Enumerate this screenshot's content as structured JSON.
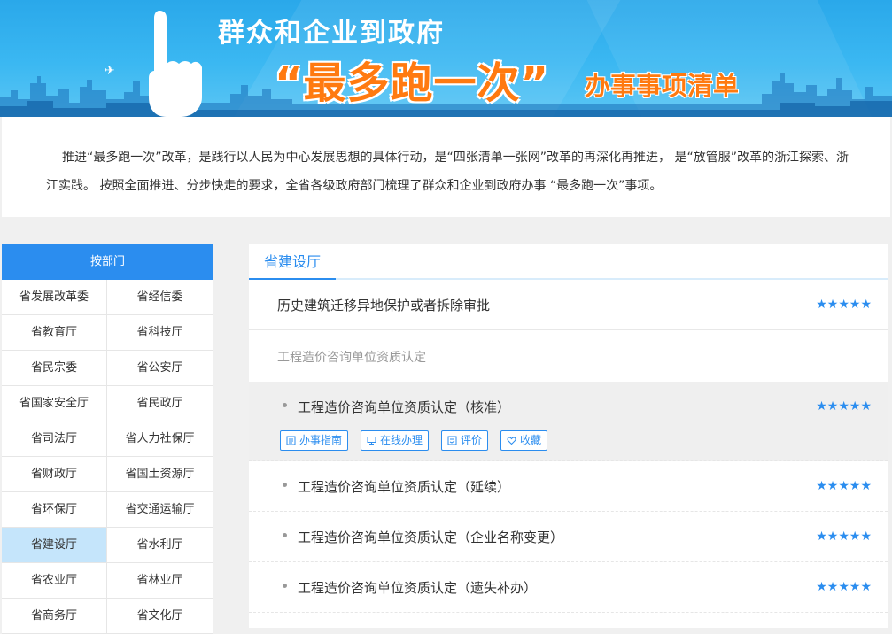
{
  "banner": {
    "line1": "群众和企业到政府",
    "quote": "“最多跑一次”",
    "line2": "办事事项清单"
  },
  "intro": {
    "text": "推进“最多跑一次”改革，是践行以人民为中心发展思想的具体行动，是“四张清单一张网”改革的再深化再推进， 是“放管服”改革的浙江探索、浙江实践。 按照全面推进、分步快走的要求，全省各级政府部门梳理了群众和企业到政府办事 “最多跑一次”事项。"
  },
  "sidebar": {
    "header": "按部门",
    "items": [
      {
        "label": "省发展改革委"
      },
      {
        "label": "省经信委"
      },
      {
        "label": "省教育厅"
      },
      {
        "label": "省科技厅"
      },
      {
        "label": "省民宗委"
      },
      {
        "label": "省公安厅"
      },
      {
        "label": "省国家安全厅"
      },
      {
        "label": "省民政厅"
      },
      {
        "label": "省司法厅"
      },
      {
        "label": "省人力社保厅"
      },
      {
        "label": "省财政厅"
      },
      {
        "label": "省国土资源厅"
      },
      {
        "label": "省环保厅"
      },
      {
        "label": "省交通运输厅"
      },
      {
        "label": "省建设厅"
      },
      {
        "label": "省水利厅"
      },
      {
        "label": "省农业厅"
      },
      {
        "label": "省林业厅"
      },
      {
        "label": "省商务厅"
      },
      {
        "label": "省文化厅"
      }
    ],
    "active_label": "省建设厅"
  },
  "main": {
    "tab": "省建设厅",
    "rows": [
      {
        "label": "历史建筑迁移异地保护或者拆除审批",
        "stars": "★★★★★"
      },
      {
        "group": "工程造价咨询单位资质认定"
      },
      {
        "label": "工程造价咨询单位资质认定（核准）",
        "stars": "★★★★★"
      },
      {
        "label": "工程造价咨询单位资质认定（延续）",
        "stars": "★★★★★"
      },
      {
        "label": "工程造价咨询单位资质认定（企业名称变更）",
        "stars": "★★★★★"
      },
      {
        "label": "工程造价咨询单位资质认定（遗失补办）",
        "stars": "★★★★★"
      }
    ],
    "actions": {
      "guide": "办事指南",
      "online": "在线办理",
      "rate": "评价",
      "fav": "收藏"
    }
  },
  "colors": {
    "accent": "#2b8def",
    "banner_orange": "#ff7a10",
    "active_bg": "#c5e5fb"
  }
}
